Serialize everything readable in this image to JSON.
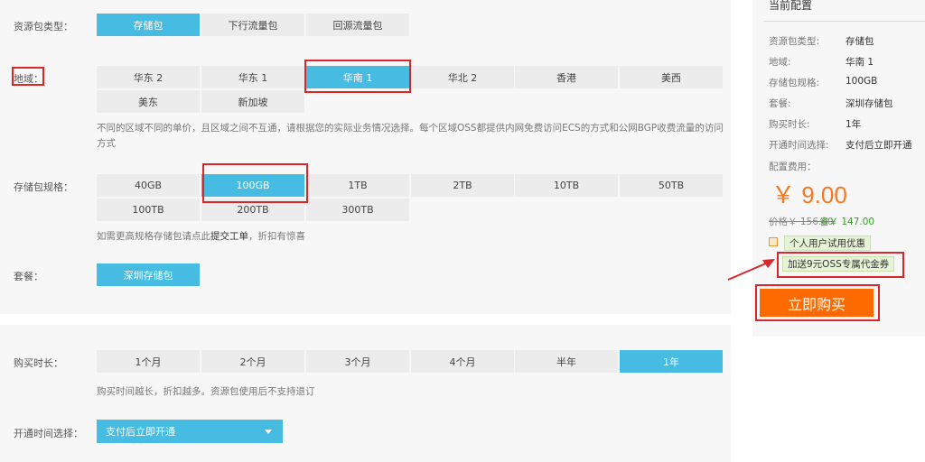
{
  "package_type": {
    "label": "资源包类型：",
    "options": [
      "存储包",
      "下行流量包",
      "回源流量包"
    ]
  },
  "region": {
    "label": "地域：",
    "options": [
      "华东 2",
      "华东 1",
      "华南 1",
      "华北 2",
      "香港",
      "美西",
      "美东",
      "新加坡"
    ],
    "hint": "不同的区域不同的单价，且区域之间不互通，请根据您的实际业务情况选择。每个区域OSS都提供内网免费访问ECS的方式和公网BGP收费流量的访问方式"
  },
  "spec": {
    "label": "存储包规格：",
    "options": [
      "40GB",
      "100GB",
      "1TB",
      "2TB",
      "10TB",
      "50TB",
      "100TB",
      "200TB",
      "300TB"
    ],
    "hint_prefix": "如需更高规格存储包请点此",
    "hint_link": "提交工单",
    "hint_suffix": "，折扣有惊喜"
  },
  "plan": {
    "label": "套餐：",
    "value": "深圳存储包"
  },
  "duration": {
    "label": "购买时长：",
    "options": [
      "1个月",
      "2个月",
      "3个月",
      "4个月",
      "半年",
      "1年"
    ],
    "hint": "购买时间越长，折扣越多。资源包使用后不支持退订"
  },
  "activation": {
    "label": "开通时间选择：",
    "value": "支付后立即开通"
  },
  "summary": {
    "title": "当前配置",
    "rows": [
      {
        "k": "资源包类型:",
        "v": "存储包"
      },
      {
        "k": "地域:",
        "v": "华南 1"
      },
      {
        "k": "存储包规格:",
        "v": "100GB"
      },
      {
        "k": "套餐:",
        "v": "深圳存储包"
      },
      {
        "k": "购买时长:",
        "v": "1年"
      },
      {
        "k": "开通时间选择:",
        "v": "支付后立即开通"
      }
    ],
    "fee_label": "配置费用：",
    "price": "￥ 9.00",
    "original": "价格￥ 156.00",
    "saving": "省￥ 147.00",
    "promo_personal": "个人用户试用优惠",
    "promo_voucher": "加送9元OSS专属代金券",
    "buy_label": "立即购买"
  },
  "colors": {
    "selected": "#47bce3",
    "price": "#f47920",
    "buy": "#ff6a00",
    "highlight": "#d9262b"
  }
}
